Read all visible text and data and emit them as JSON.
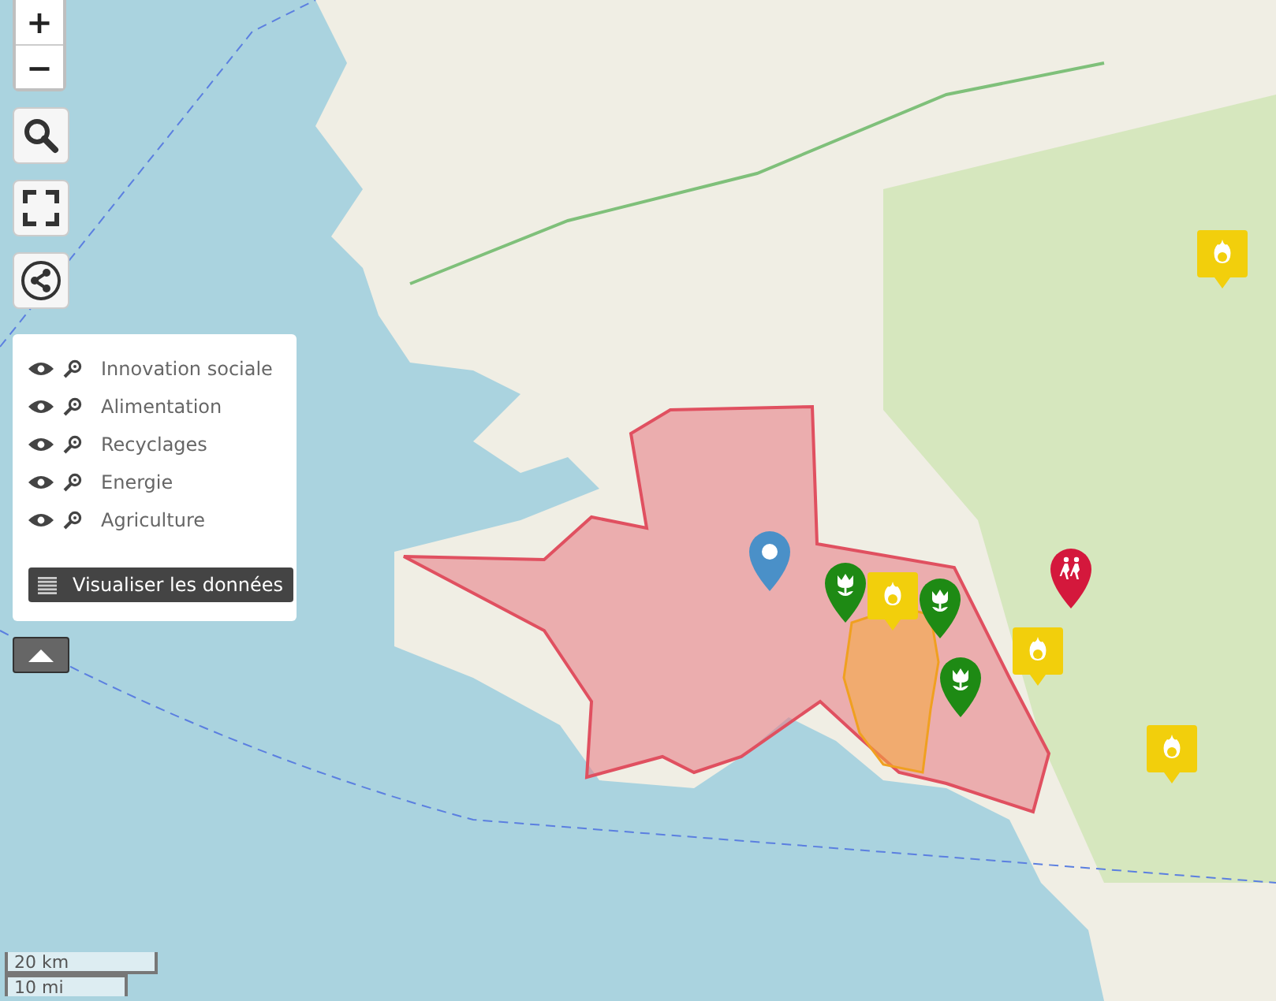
{
  "zoom_controls": {
    "zoom_in": "+",
    "zoom_out": "−"
  },
  "layers": [
    {
      "label": "Innovation sociale"
    },
    {
      "label": "Alimentation"
    },
    {
      "label": "Recyclages"
    },
    {
      "label": "Energie"
    },
    {
      "label": "Agriculture"
    }
  ],
  "data_button": "Visualiser les données",
  "markers": [
    {
      "kind": "location",
      "color": "#4a90c8"
    },
    {
      "kind": "flower",
      "color": "#1e8a14"
    },
    {
      "kind": "flame",
      "color": "#f2cf0c"
    },
    {
      "kind": "flower",
      "color": "#1e8a14"
    },
    {
      "kind": "flower",
      "color": "#1e8a14"
    },
    {
      "kind": "flame",
      "color": "#f2cf0c"
    },
    {
      "kind": "runners",
      "color": "#d4183c"
    },
    {
      "kind": "flame",
      "color": "#f2cf0c"
    },
    {
      "kind": "flame",
      "color": "#f2cf0c"
    }
  ],
  "scale": {
    "metric": "20 km",
    "imperial": "10 mi"
  }
}
